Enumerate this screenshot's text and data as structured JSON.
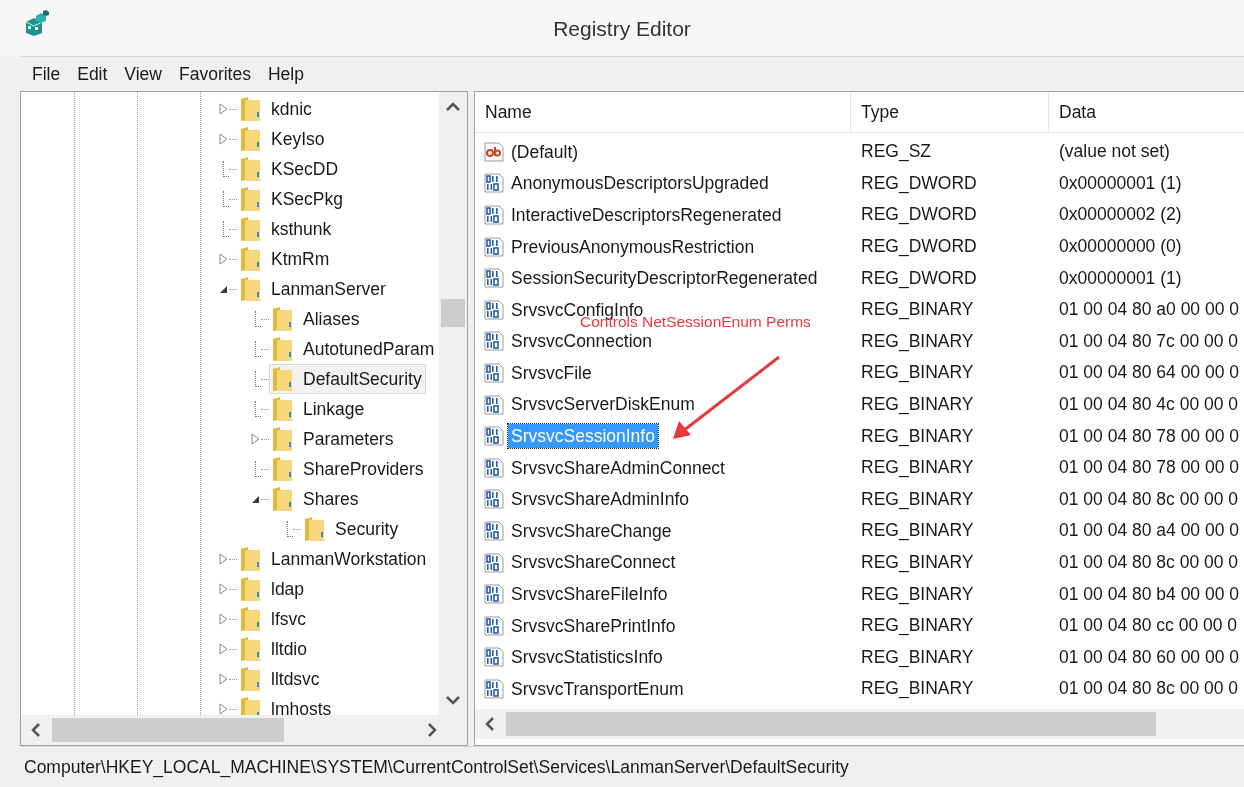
{
  "window": {
    "title": "Registry Editor"
  },
  "menu": [
    "File",
    "Edit",
    "View",
    "Favorites",
    "Help"
  ],
  "tree": [
    {
      "label": "kdnic",
      "kind": "collapsed",
      "selected": false
    },
    {
      "label": "KeyIso",
      "kind": "collapsed",
      "selected": false
    },
    {
      "label": "KSecDD",
      "kind": "leaf",
      "selected": false
    },
    {
      "label": "KSecPkg",
      "kind": "leaf",
      "selected": false
    },
    {
      "label": "ksthunk",
      "kind": "leaf",
      "selected": false
    },
    {
      "label": "KtmRm",
      "kind": "collapsed",
      "selected": false
    },
    {
      "label": "LanmanServer",
      "kind": "expanded",
      "selected": false,
      "children": [
        {
          "label": "Aliases",
          "kind": "leaf",
          "selected": false
        },
        {
          "label": "AutotunedParam",
          "kind": "leaf",
          "selected": false
        },
        {
          "label": "DefaultSecurity",
          "kind": "leaf",
          "selected": true
        },
        {
          "label": "Linkage",
          "kind": "leaf",
          "selected": false
        },
        {
          "label": "Parameters",
          "kind": "collapsed",
          "selected": false
        },
        {
          "label": "ShareProviders",
          "kind": "leaf",
          "selected": false
        },
        {
          "label": "Shares",
          "kind": "expanded",
          "selected": false,
          "children": [
            {
              "label": "Security",
              "kind": "leaf",
              "selected": false
            }
          ]
        }
      ]
    },
    {
      "label": "LanmanWorkstation",
      "kind": "collapsed",
      "selected": false
    },
    {
      "label": "ldap",
      "kind": "collapsed",
      "selected": false
    },
    {
      "label": "lfsvc",
      "kind": "collapsed",
      "selected": false
    },
    {
      "label": "lltdio",
      "kind": "collapsed",
      "selected": false
    },
    {
      "label": "lltdsvc",
      "kind": "collapsed",
      "selected": false
    },
    {
      "label": "lmhosts",
      "kind": "collapsed",
      "selected": false
    }
  ],
  "table": {
    "columns": [
      "Name",
      "Type",
      "Data"
    ],
    "rows": [
      {
        "kind": "string",
        "name": "(Default)",
        "type": "REG_SZ",
        "data": "(value not set)",
        "selected": false
      },
      {
        "kind": "binary",
        "name": "AnonymousDescriptorsUpgraded",
        "type": "REG_DWORD",
        "data": "0x00000001 (1)",
        "selected": false
      },
      {
        "kind": "binary",
        "name": "InteractiveDescriptorsRegenerated",
        "type": "REG_DWORD",
        "data": "0x00000002 (2)",
        "selected": false
      },
      {
        "kind": "binary",
        "name": "PreviousAnonymousRestriction",
        "type": "REG_DWORD",
        "data": "0x00000000 (0)",
        "selected": false
      },
      {
        "kind": "binary",
        "name": "SessionSecurityDescriptorRegenerated",
        "type": "REG_DWORD",
        "data": "0x00000001 (1)",
        "selected": false
      },
      {
        "kind": "binary",
        "name": "SrvsvcConfigInfo",
        "type": "REG_BINARY",
        "data": "01 00 04 80 a0 00 00 0",
        "selected": false
      },
      {
        "kind": "binary",
        "name": "SrvsvcConnection",
        "type": "REG_BINARY",
        "data": "01 00 04 80 7c 00 00 0",
        "selected": false
      },
      {
        "kind": "binary",
        "name": "SrvsvcFile",
        "type": "REG_BINARY",
        "data": "01 00 04 80 64 00 00 0",
        "selected": false
      },
      {
        "kind": "binary",
        "name": "SrvsvcServerDiskEnum",
        "type": "REG_BINARY",
        "data": "01 00 04 80 4c 00 00 0",
        "selected": false
      },
      {
        "kind": "binary",
        "name": "SrvsvcSessionInfo",
        "type": "REG_BINARY",
        "data": "01 00 04 80 78 00 00 0",
        "selected": true
      },
      {
        "kind": "binary",
        "name": "SrvsvcShareAdminConnect",
        "type": "REG_BINARY",
        "data": "01 00 04 80 78 00 00 0",
        "selected": false
      },
      {
        "kind": "binary",
        "name": "SrvsvcShareAdminInfo",
        "type": "REG_BINARY",
        "data": "01 00 04 80 8c 00 00 0",
        "selected": false
      },
      {
        "kind": "binary",
        "name": "SrvsvcShareChange",
        "type": "REG_BINARY",
        "data": "01 00 04 80 a4 00 00 0",
        "selected": false
      },
      {
        "kind": "binary",
        "name": "SrvsvcShareConnect",
        "type": "REG_BINARY",
        "data": "01 00 04 80 8c 00 00 0",
        "selected": false
      },
      {
        "kind": "binary",
        "name": "SrvsvcShareFileInfo",
        "type": "REG_BINARY",
        "data": "01 00 04 80 b4 00 00 0",
        "selected": false
      },
      {
        "kind": "binary",
        "name": "SrvsvcSharePrintInfo",
        "type": "REG_BINARY",
        "data": "01 00 04 80 cc 00 00 0",
        "selected": false
      },
      {
        "kind": "binary",
        "name": "SrvsvcStatisticsInfo",
        "type": "REG_BINARY",
        "data": "01 00 04 80 60 00 00 0",
        "selected": false
      },
      {
        "kind": "binary",
        "name": "SrvsvcTransportEnum",
        "type": "REG_BINARY",
        "data": "01 00 04 80 8c 00 00 0",
        "selected": false
      }
    ]
  },
  "annotation": {
    "text": "Controls NetSessionEnum Perms"
  },
  "status_bar": "Computer\\HKEY_LOCAL_MACHINE\\SYSTEM\\CurrentControlSet\\Services\\LanmanServer\\DefaultSecurity"
}
